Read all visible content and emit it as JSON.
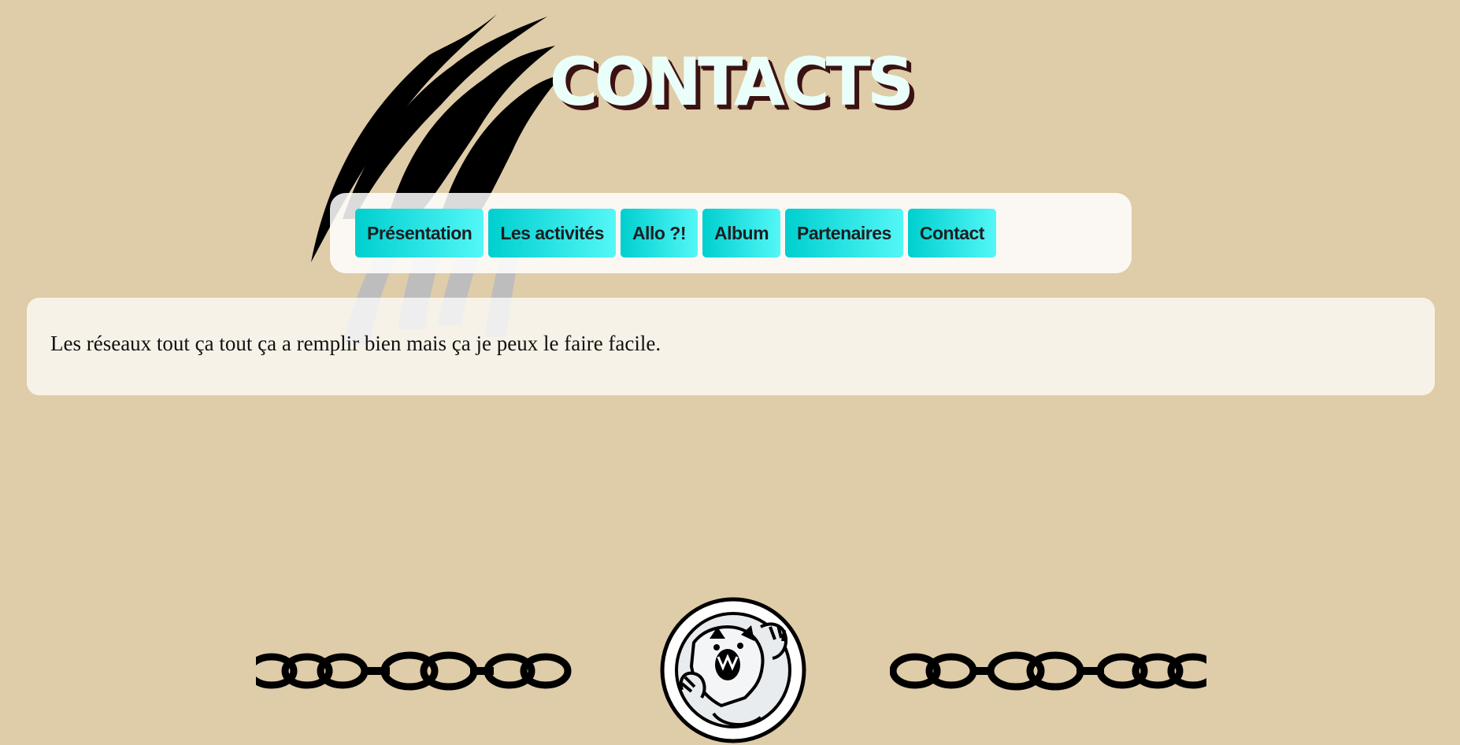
{
  "header": {
    "title": "CONTACTS"
  },
  "nav": {
    "items": [
      {
        "label": "Présentation"
      },
      {
        "label": "Les activités"
      },
      {
        "label": "Allo ?!"
      },
      {
        "label": "Album"
      },
      {
        "label": "Partenaires"
      },
      {
        "label": "Contact"
      }
    ]
  },
  "content": {
    "text": "Les réseaux tout ça tout ça a remplir bien mais ça je peux le faire facile."
  },
  "icons": {
    "background": "claw-marks-icon",
    "chains": "chain-icon",
    "logo": "bear-emblem-icon"
  },
  "colors": {
    "background": "#dfcca8",
    "nav_button_start": "#00cfcf",
    "nav_button_end": "#54f7f7",
    "title_fill": "#eafffa",
    "title_shadow": "#3b1212"
  }
}
